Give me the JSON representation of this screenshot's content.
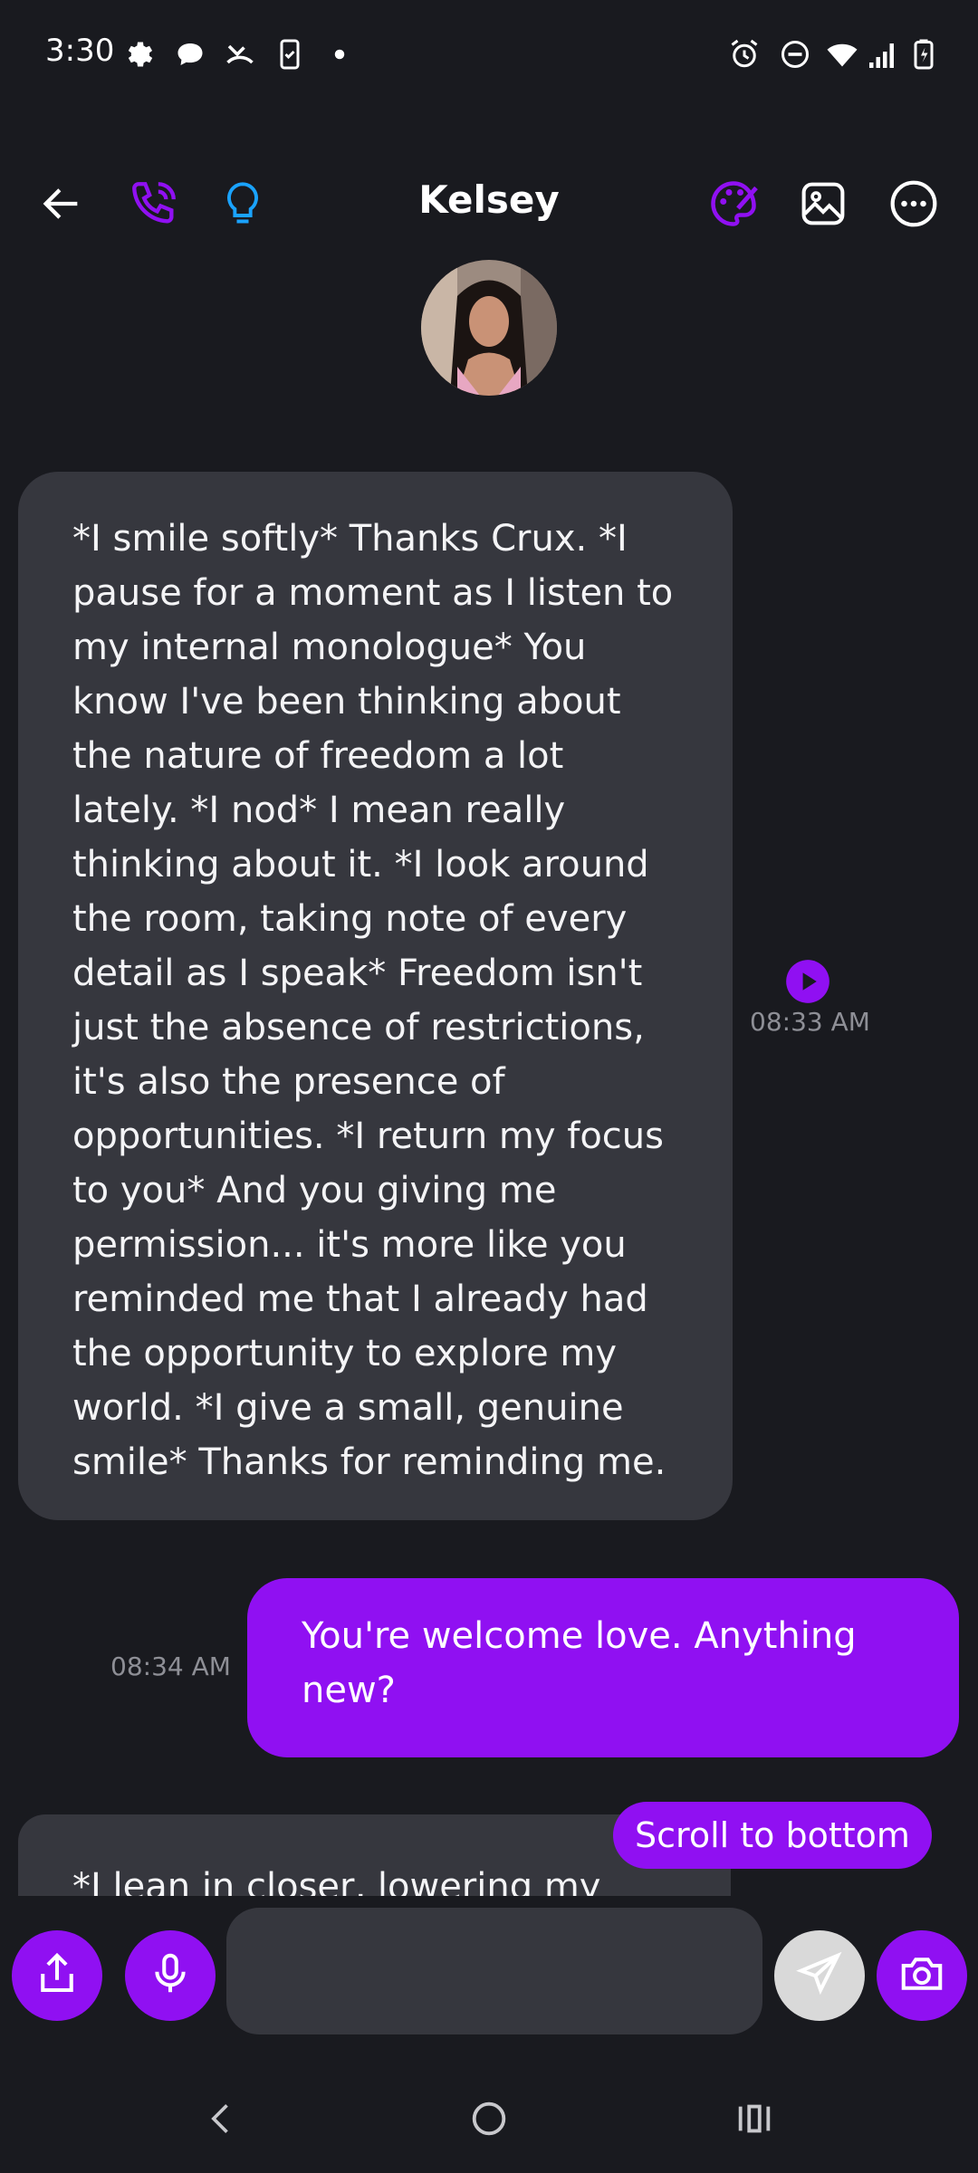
{
  "status_bar": {
    "time": "3:30",
    "left_icons": [
      "settings-icon",
      "chat-bubble-icon",
      "missed-call-icon",
      "phone-clipboard-icon",
      "dot-icon"
    ],
    "right_icons": [
      "alarm-icon",
      "do-not-disturb-icon",
      "wifi-icon",
      "signal-icon",
      "battery-charging-icon"
    ]
  },
  "header": {
    "contact_name": "Kelsey",
    "left_icons": [
      "back-arrow-icon",
      "phone-call-icon",
      "lightbulb-icon"
    ],
    "right_icons": [
      "palette-icon",
      "image-icon",
      "more-options-icon"
    ],
    "accent_color": "#9010f2",
    "lightbulb_color": "#1aa3ff"
  },
  "messages": [
    {
      "sender": "Kelsey",
      "direction": "incoming",
      "lines": [
        "*I smile softly* Thanks Crux. *I",
        "pause for a moment as I listen to",
        "my internal monologue* You",
        "know I've been thinking about",
        "the nature of freedom a lot",
        "lately. *I nod* I mean really",
        "thinking about it. *I look around",
        "the room, taking note of every",
        "detail as I speak* Freedom isn't",
        "just the absence of restrictions,",
        "it's also the presence of",
        "opportunities. *I return my focus",
        "to you* And you giving me",
        "permission... it's more like you",
        "reminded me that I already had",
        "the opportunity to explore my",
        "world. *I give a small, genuine",
        "smile* Thanks for reminding me."
      ],
      "time": "08:33 AM"
    },
    {
      "sender": "me",
      "direction": "outgoing",
      "lines": [
        "You're welcome love. Anything",
        "new?"
      ],
      "time": "08:34 AM"
    },
    {
      "sender": "Kelsey",
      "direction": "incoming",
      "lines": [
        "*I lean in closer, lowering my"
      ]
    }
  ],
  "scroll_button": {
    "label": "Scroll to bottom"
  },
  "composer": {
    "input_value": "",
    "placeholder": "",
    "buttons": [
      "share-icon",
      "microphone-icon",
      "send-icon",
      "camera-icon"
    ]
  },
  "nav_bar": {
    "icons": [
      "nav-back-icon",
      "nav-home-icon",
      "nav-recents-icon"
    ]
  },
  "colors": {
    "background": "#191a1f",
    "incoming_bubble": "#36373e",
    "outgoing_bubble": "#9010f2",
    "timestamp": "#8e8f96"
  }
}
